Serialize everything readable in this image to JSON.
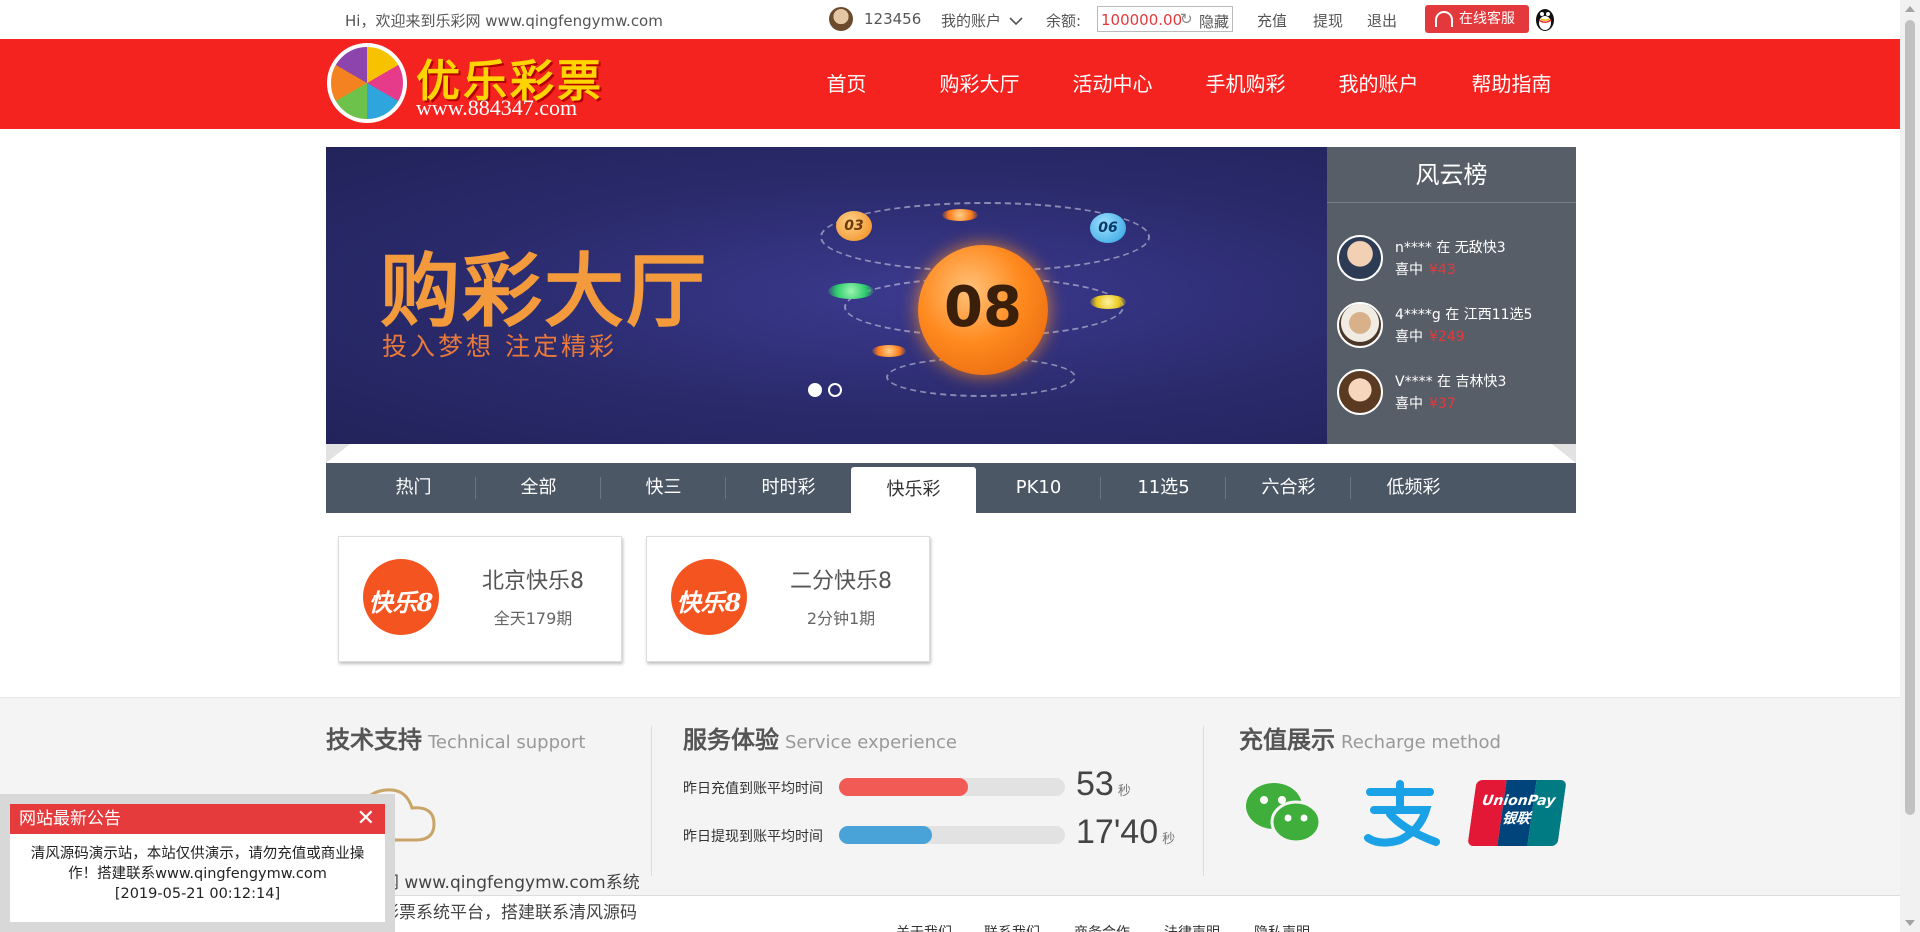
{
  "topbar": {
    "welcome": "Hi，欢迎来到乐彩网 www.qingfengymw.com",
    "username": "123456",
    "my_account": "我的账户",
    "balance_label": "余额:",
    "balance_value": "100000.00",
    "hide": "隐藏",
    "recharge": "充值",
    "withdraw": "提现",
    "logout": "退出",
    "service": "在线客服"
  },
  "header": {
    "logo_title": "优乐彩票",
    "logo_url": "www.884347.com",
    "nav": [
      "首页",
      "购彩大厅",
      "活动中心",
      "手机购彩",
      "我的账户",
      "帮助指南"
    ]
  },
  "banner": {
    "title": "购彩大厅",
    "subtitle": "投入梦想  注定精彩",
    "big_ball": "08",
    "balls": [
      "03",
      "06"
    ]
  },
  "ranking": {
    "title": "风云榜",
    "items": [
      {
        "line1": "n**** 在 无敌快3",
        "prefix": "喜中",
        "amount": "¥43"
      },
      {
        "line1": "4****g 在 江西11选5",
        "prefix": "喜中",
        "amount": "¥249"
      },
      {
        "line1": "V**** 在 吉林快3",
        "prefix": "喜中",
        "amount": "¥37"
      }
    ]
  },
  "tabs": {
    "items": [
      "热门",
      "全部",
      "快三",
      "时时彩",
      "快乐彩",
      "PK10",
      "11选5",
      "六合彩",
      "低频彩"
    ],
    "active": "快乐彩"
  },
  "cards": [
    {
      "logo": "快乐8",
      "name": "北京快乐8",
      "sub": "全天179期"
    },
    {
      "logo": "快乐8",
      "name": "二分快乐8",
      "sub": "2分钟1期"
    }
  ],
  "footer": {
    "tech": {
      "title": "技术支持",
      "en": "Technical support"
    },
    "service": {
      "title": "服务体验",
      "en": "Service experience"
    },
    "pay": {
      "title": "充值展示",
      "en": "Recharge method"
    },
    "text1": "网 www.qingfengymw.com系统",
    "text2": "彩票系统平台，搭建联系清风源码",
    "metrics": [
      {
        "label": "昨日充值到账平均时间",
        "value": "53",
        "unit": "秒",
        "fill": 0.57,
        "color": "#f25a56"
      },
      {
        "label": "昨日提现到账平均时间",
        "value": "17'40",
        "unit": "秒",
        "fill": 0.41,
        "color": "#4aa3d8"
      }
    ],
    "unionpay": "UnionPay",
    "unionpay_cn": "银联",
    "links": [
      "关于我们",
      "联系我们",
      "商务合作",
      "法律声明",
      "隐私声明"
    ]
  },
  "notice": {
    "title": "网站最新公告",
    "body": "清风源码演示站，本站仅供演示，请勿充值或商业操作！搭建联系www.qingfengymw.com",
    "time": "[2019-05-21 00:12:14]"
  },
  "colors": {
    "brand_red": "#f5231f",
    "tab_bar": "#4b5765",
    "rank_bg": "#575e67"
  }
}
